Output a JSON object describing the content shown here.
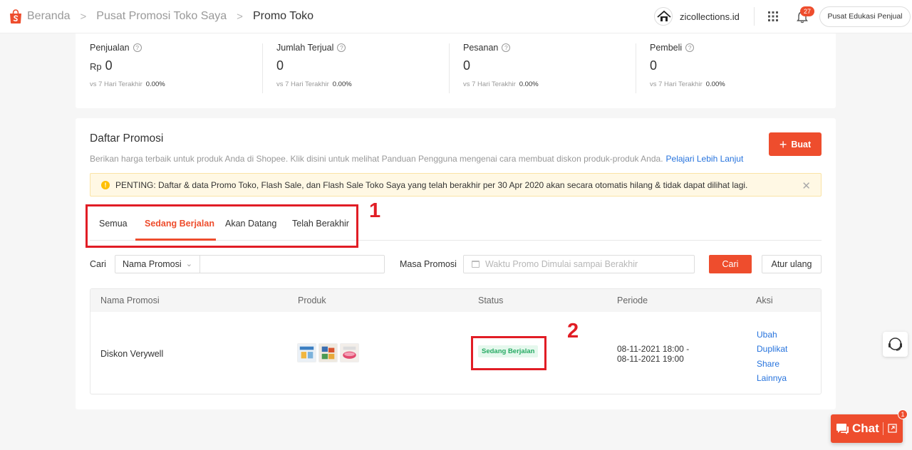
{
  "header": {
    "breadcrumbs": [
      {
        "label": "Beranda"
      },
      {
        "label": "Pusat Promosi Toko Saya"
      },
      {
        "label": "Promo Toko"
      }
    ],
    "shop_name": "zicollections.id",
    "notification_count": "27",
    "edu_button_label": "Pusat Edukasi Penjual",
    "brand_color": "#ee4d2d"
  },
  "stats": {
    "compare_label": "vs 7 Hari Terakhir",
    "items": [
      {
        "label": "Penjualan",
        "prefix": "Rp",
        "value": "0",
        "change": "0.00%"
      },
      {
        "label": "Jumlah Terjual",
        "prefix": "",
        "value": "0",
        "change": "0.00%"
      },
      {
        "label": "Pesanan",
        "prefix": "",
        "value": "0",
        "change": "0.00%"
      },
      {
        "label": "Pembeli",
        "prefix": "",
        "value": "0",
        "change": "0.00%"
      }
    ]
  },
  "promo": {
    "title": "Daftar Promosi",
    "description": "Berikan harga terbaik untuk produk Anda di Shopee. Klik disini untuk melihat Panduan Pengguna mengenai cara membuat diskon produk-produk Anda.",
    "learn_more": "Pelajari Lebih Lanjut",
    "create_label": "Buat",
    "notice": "PENTING: Daftar & data Promo Toko, Flash Sale, dan Flash Sale Toko Saya yang telah berakhir per 30 Apr 2020 akan secara otomatis hilang & tidak dapat dilihat lagi.",
    "tabs": [
      {
        "label": "Semua"
      },
      {
        "label": "Sedang Berjalan",
        "active": true
      },
      {
        "label": "Akan Datang"
      },
      {
        "label": "Telah Berakhir"
      }
    ],
    "filter": {
      "search_label": "Cari",
      "select_value": "Nama Promosi",
      "search_value": "",
      "period_label": "Masa Promosi",
      "date_placeholder": "Waktu Promo Dimulai sampai Berakhir",
      "search_button": "Cari",
      "reset_button": "Atur ulang"
    },
    "table": {
      "headers": [
        "Nama Promosi",
        "Produk",
        "Status",
        "Periode",
        "Aksi"
      ],
      "rows": [
        {
          "name": "Diskon Verywell",
          "status": "Sedang Berjalan",
          "period_start": "08-11-2021 18:00 -",
          "period_end": "08-11-2021 19:00",
          "actions": [
            "Ubah",
            "Duplikat",
            "Share",
            "Lainnya"
          ]
        }
      ]
    }
  },
  "annotations": [
    "1",
    "2"
  ],
  "chat": {
    "label": "Chat",
    "badge": "1"
  }
}
